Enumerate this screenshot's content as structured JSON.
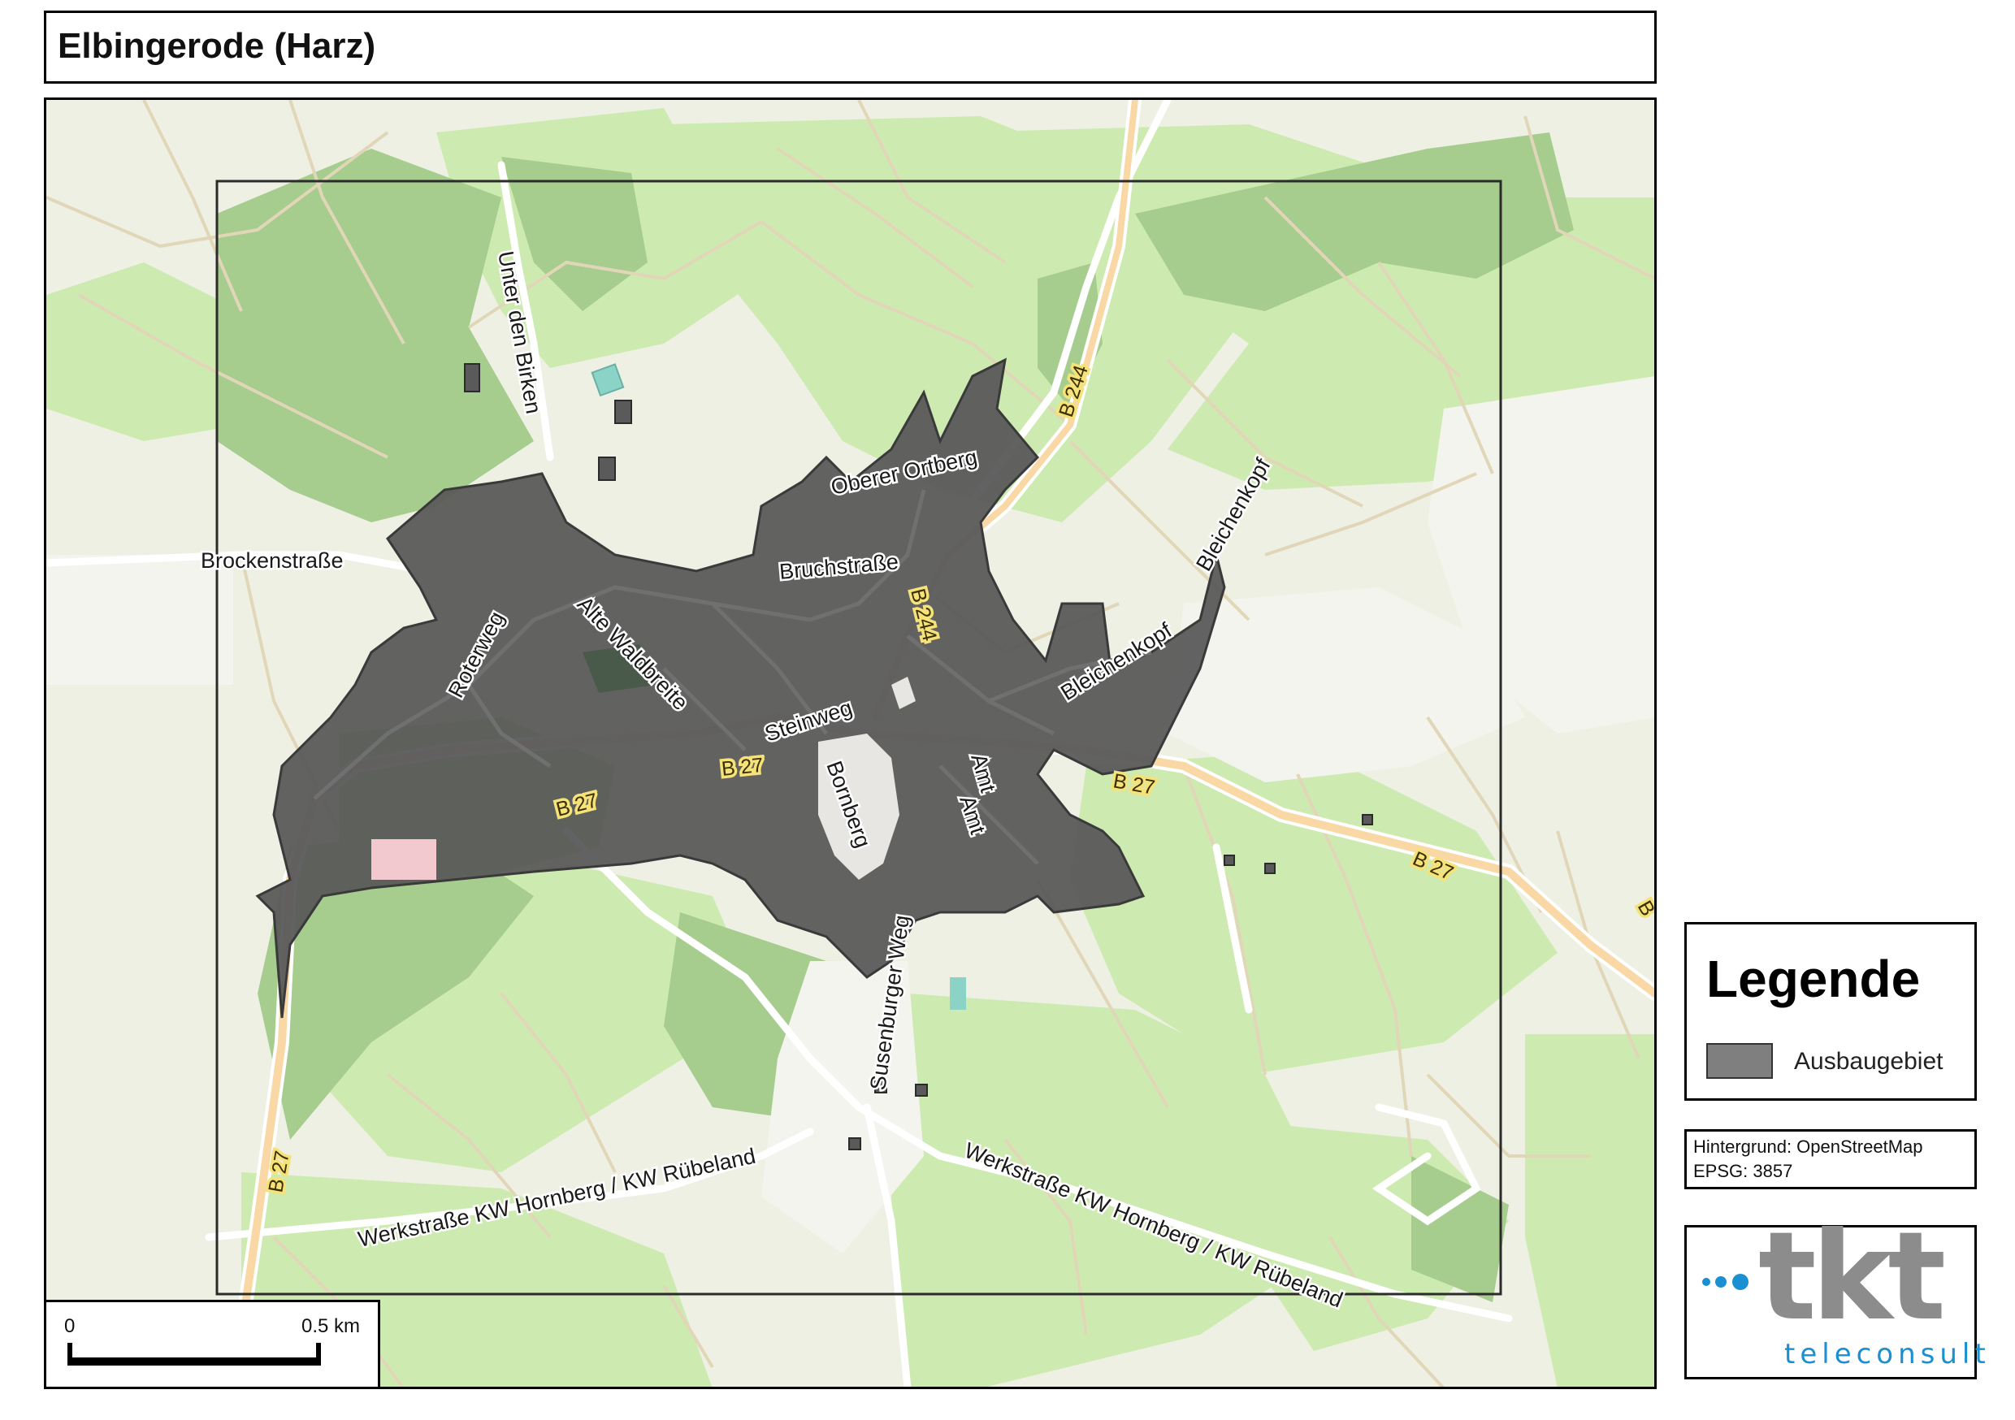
{
  "title": "Elbingerode (Harz)",
  "map": {
    "street_labels": [
      "Unter den Birken",
      "Brockenstraße",
      "Oberer Ortberg",
      "Bruchstraße",
      "Alte Waldbreite",
      "Roterweg",
      "Steinweg",
      "Bornberg",
      "Amt",
      "Amt",
      "Bleichenkopf",
      "Bleichenkopf",
      "Susenburger Weg",
      "Werkstraße KW Hornberg / KW Rübeland",
      "Werkstraße KW Hornberg / KW Rübeland"
    ],
    "road_shields": [
      "B 244",
      "B 244",
      "B 27",
      "B 27",
      "B 27",
      "B 27",
      "B 27",
      "B"
    ],
    "colors": {
      "forest": "#a6cc8e",
      "forest_dark": "#9cc285",
      "meadow": "#cdebb0",
      "background": "#eef0e4",
      "road": "#ffffff",
      "primary_road": "#f9d8a6",
      "track": "#e1d7b8",
      "ausbaugebiet": "#5a5a5a"
    }
  },
  "scalebar": {
    "start": "0",
    "end": "0.5 km"
  },
  "legend": {
    "heading": "Legende",
    "items": [
      {
        "label": "Ausbaugebiet",
        "color": "#7f7f7f"
      }
    ]
  },
  "source": {
    "line1": "Hintergrund: OpenStreetMap",
    "line2": "EPSG: 3857"
  },
  "logo": {
    "brand": "tkt",
    "subtitle": "teleconsult",
    "dot_color": "#1a8fd1",
    "brand_color": "#8c8c8c"
  }
}
